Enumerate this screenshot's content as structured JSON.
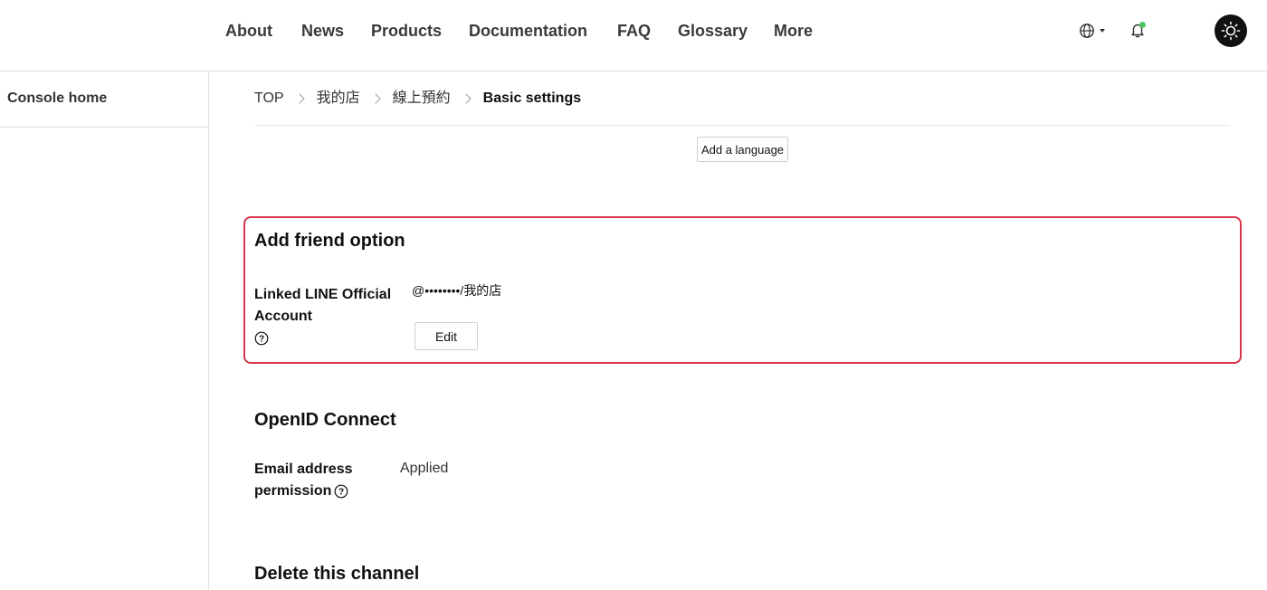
{
  "nav": {
    "items": [
      "About",
      "News",
      "Products",
      "Documentation",
      "FAQ",
      "Glossary",
      "More"
    ]
  },
  "sidebar": {
    "console_home": "Console home"
  },
  "breadcrumb": {
    "items": [
      "TOP",
      "我的店",
      "線上預約",
      "Basic settings"
    ]
  },
  "buttons": {
    "add_language": "Add a language",
    "edit": "Edit"
  },
  "add_friend": {
    "title": "Add friend option",
    "label_line1": "Linked LINE Official",
    "label_line2": "Account",
    "value": "@••••••••/我的店"
  },
  "openid": {
    "title": "OpenID Connect",
    "label_line1": "Email address",
    "label_line2": "permission",
    "value": "Applied"
  },
  "delete_channel": {
    "title": "Delete this channel"
  },
  "colors": {
    "highlight": "#d8344c",
    "notification_dot": "#4cc764"
  },
  "icons": [
    "globe-icon",
    "bell-icon",
    "sun-icon",
    "help-icon",
    "chevron-right-icon"
  ]
}
